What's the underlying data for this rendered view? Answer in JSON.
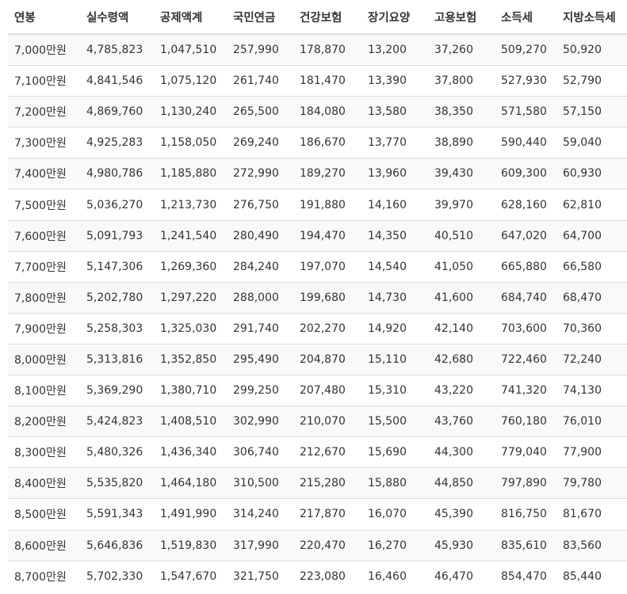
{
  "table": {
    "headers": [
      "연봉",
      "실수령액",
      "공제액계",
      "국민연금",
      "건강보험",
      "장기요양",
      "고용보험",
      "소득세",
      "지방소득세"
    ],
    "rows": [
      [
        "7,000만원",
        "4,785,823",
        "1,047,510",
        "257,990",
        "178,870",
        "13,200",
        "37,260",
        "509,270",
        "50,920"
      ],
      [
        "7,100만원",
        "4,841,546",
        "1,075,120",
        "261,740",
        "181,470",
        "13,390",
        "37,800",
        "527,930",
        "52,790"
      ],
      [
        "7,200만원",
        "4,869,760",
        "1,130,240",
        "265,500",
        "184,080",
        "13,580",
        "38,350",
        "571,580",
        "57,150"
      ],
      [
        "7,300만원",
        "4,925,283",
        "1,158,050",
        "269,240",
        "186,670",
        "13,770",
        "38,890",
        "590,440",
        "59,040"
      ],
      [
        "7,400만원",
        "4,980,786",
        "1,185,880",
        "272,990",
        "189,270",
        "13,960",
        "39,430",
        "609,300",
        "60,930"
      ],
      [
        "7,500만원",
        "5,036,270",
        "1,213,730",
        "276,750",
        "191,880",
        "14,160",
        "39,970",
        "628,160",
        "62,810"
      ],
      [
        "7,600만원",
        "5,091,793",
        "1,241,540",
        "280,490",
        "194,470",
        "14,350",
        "40,510",
        "647,020",
        "64,700"
      ],
      [
        "7,700만원",
        "5,147,306",
        "1,269,360",
        "284,240",
        "197,070",
        "14,540",
        "41,050",
        "665,880",
        "66,580"
      ],
      [
        "7,800만원",
        "5,202,780",
        "1,297,220",
        "288,000",
        "199,680",
        "14,730",
        "41,600",
        "684,740",
        "68,470"
      ],
      [
        "7,900만원",
        "5,258,303",
        "1,325,030",
        "291,740",
        "202,270",
        "14,920",
        "42,140",
        "703,600",
        "70,360"
      ],
      [
        "8,000만원",
        "5,313,816",
        "1,352,850",
        "295,490",
        "204,870",
        "15,110",
        "42,680",
        "722,460",
        "72,240"
      ],
      [
        "8,100만원",
        "5,369,290",
        "1,380,710",
        "299,250",
        "207,480",
        "15,310",
        "43,220",
        "741,320",
        "74,130"
      ],
      [
        "8,200만원",
        "5,424,823",
        "1,408,510",
        "302,990",
        "210,070",
        "15,500",
        "43,760",
        "760,180",
        "76,010"
      ],
      [
        "8,300만원",
        "5,480,326",
        "1,436,340",
        "306,740",
        "212,670",
        "15,690",
        "44,300",
        "779,040",
        "77,900"
      ],
      [
        "8,400만원",
        "5,535,820",
        "1,464,180",
        "310,500",
        "215,280",
        "15,880",
        "44,850",
        "797,890",
        "79,780"
      ],
      [
        "8,500만원",
        "5,591,343",
        "1,491,990",
        "314,240",
        "217,870",
        "16,070",
        "45,390",
        "816,750",
        "81,670"
      ],
      [
        "8,600만원",
        "5,646,836",
        "1,519,830",
        "317,990",
        "220,470",
        "16,270",
        "45,930",
        "835,610",
        "83,560"
      ],
      [
        "8,700만원",
        "5,702,330",
        "1,547,670",
        "321,750",
        "223,080",
        "16,460",
        "46,470",
        "854,470",
        "85,440"
      ]
    ]
  },
  "colors": {
    "border": "#dddddd",
    "stripe": "#f9f9f9",
    "text": "#333333"
  }
}
